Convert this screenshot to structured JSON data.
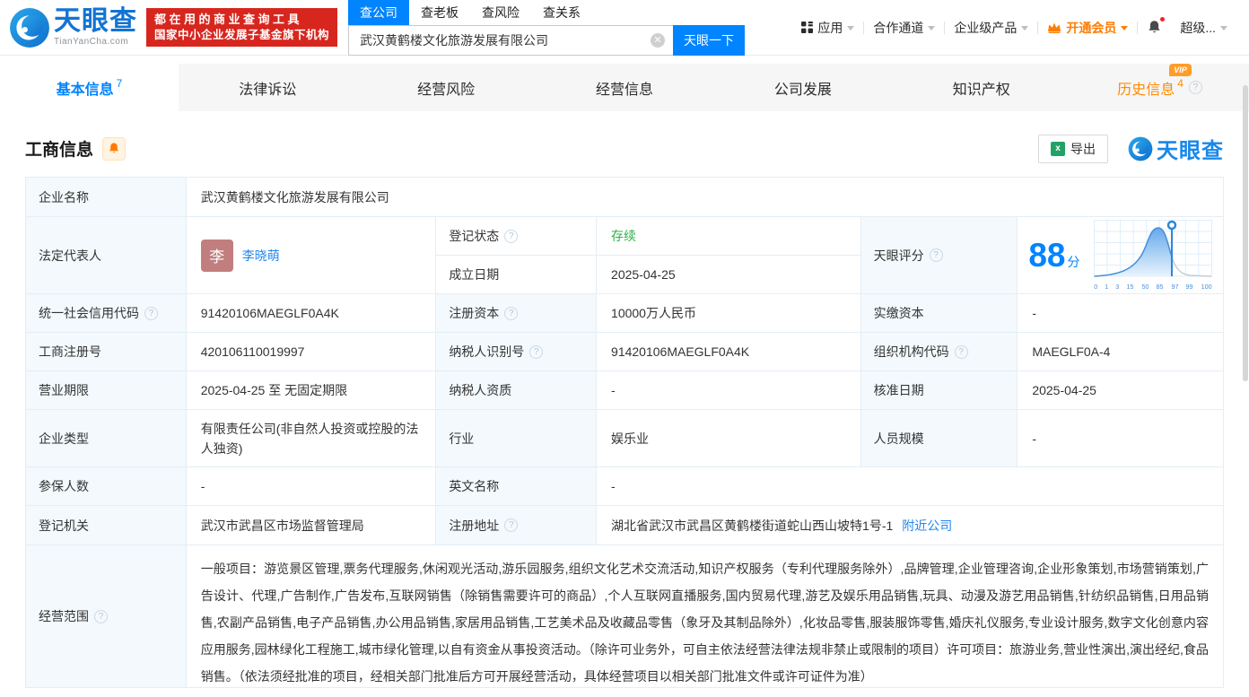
{
  "header": {
    "brand": "天眼查",
    "brand_domain": "TianYanCha.com",
    "slogan_line1": "都在用的商业查询工具",
    "slogan_line2": "国家中小企业发展子基金旗下机构",
    "search_tabs": [
      {
        "label": "查公司",
        "active": true
      },
      {
        "label": "查老板",
        "active": false
      },
      {
        "label": "查风险",
        "active": false
      },
      {
        "label": "查关系",
        "active": false
      }
    ],
    "search_value": "武汉黄鹤楼文化旅游发展有限公司",
    "search_button": "天眼一下",
    "nav_app": "应用",
    "nav_partner": "合作通道",
    "nav_enterprise": "企业级产品",
    "nav_vip": "开通会员",
    "nav_user": "超级..."
  },
  "tabs": [
    {
      "label": "基本信息",
      "badge": "7",
      "active": true
    },
    {
      "label": "法律诉讼",
      "badge": "",
      "active": false
    },
    {
      "label": "经营风险",
      "badge": "",
      "active": false
    },
    {
      "label": "经营信息",
      "badge": "",
      "active": false
    },
    {
      "label": "公司发展",
      "badge": "",
      "active": false
    },
    {
      "label": "知识产权",
      "badge": "",
      "active": false
    },
    {
      "label": "历史信息",
      "badge": "4",
      "vip": "VIP",
      "active": false
    }
  ],
  "toolbar": {
    "section_title": "工商信息",
    "export_label": "导出",
    "watermark_brand": "天眼查"
  },
  "info": {
    "company_name_label": "企业名称",
    "company_name": "武汉黄鹤楼文化旅游发展有限公司",
    "legal_rep_label": "法定代表人",
    "legal_rep_avatar": "李",
    "legal_rep_name": "李晓萌",
    "reg_status_label": "登记状态",
    "reg_status": "存续",
    "established_label": "成立日期",
    "established": "2025-04-25",
    "score_label": "天眼评分",
    "score": "88",
    "score_unit": "分",
    "uscc_label": "统一社会信用代码",
    "uscc": "91420106MAEGLF0A4K",
    "reg_capital_label": "注册资本",
    "reg_capital": "10000万人民币",
    "paid_capital_label": "实缴资本",
    "paid_capital": "-",
    "reg_number_label": "工商注册号",
    "reg_number": "420106110019997",
    "taxpayer_id_label": "纳税人识别号",
    "taxpayer_id": "91420106MAEGLF0A4K",
    "org_code_label": "组织机构代码",
    "org_code": "MAEGLF0A-4",
    "business_term_label": "营业期限",
    "business_term": "2025-04-25 至 无固定期限",
    "taxpayer_quality_label": "纳税人资质",
    "taxpayer_quality": "-",
    "approval_date_label": "核准日期",
    "approval_date": "2025-04-25",
    "company_type_label": "企业类型",
    "company_type": "有限责任公司(非自然人投资或控股的法人独资)",
    "industry_label": "行业",
    "industry": "娱乐业",
    "staff_size_label": "人员规模",
    "staff_size": "-",
    "insured_label": "参保人数",
    "insured": "-",
    "english_name_label": "英文名称",
    "english_name": "-",
    "reg_authority_label": "登记机关",
    "reg_authority": "武汉市武昌区市场监督管理局",
    "reg_address_label": "注册地址",
    "reg_address": "湖北省武汉市武昌区黄鹤楼街道蛇山西山坡特1号-1",
    "nearby_link": "附近公司",
    "business_scope_label": "经营范围",
    "business_scope": "一般项目：游览景区管理,票务代理服务,休闲观光活动,游乐园服务,组织文化艺术交流活动,知识产权服务（专利代理服务除外）,品牌管理,企业管理咨询,企业形象策划,市场营销策划,广告设计、代理,广告制作,广告发布,互联网销售（除销售需要许可的商品）,个人互联网直播服务,国内贸易代理,游艺及娱乐用品销售,玩具、动漫及游艺用品销售,针纺织品销售,日用品销售,农副产品销售,电子产品销售,办公用品销售,家居用品销售,工艺美术品及收藏品零售（象牙及其制品除外）,化妆品零售,服装服饰零售,婚庆礼仪服务,专业设计服务,数字文化创意内容应用服务,园林绿化工程施工,城市绿化管理,以自有资金从事投资活动。（除许可业务外，可自主依法经营法律法规非禁止或限制的项目）许可项目：旅游业务,营业性演出,演出经纪,食品销售。（依法须经批准的项目，经相关部门批准后方可开展经营活动，具体经营项目以相关部门批准文件或许可证件为准）"
  },
  "chart_data": {
    "type": "area",
    "title": "天眼评分",
    "score": 88,
    "score_unit": "分",
    "marker_value": 88,
    "x_tick_labels": [
      "0",
      "1",
      "3",
      "15",
      "50",
      "85",
      "97",
      "99",
      "100"
    ],
    "curve": "normal-distribution",
    "legend": "none",
    "grid": "on"
  },
  "colors": {
    "primary_blue": "#0084ff",
    "status_green": "#2db14a",
    "vip_orange": "#ff8a00",
    "badge_red": "#d7261e",
    "label_cell_bg": "#f3f9fd",
    "table_border": "#e4eef6"
  }
}
